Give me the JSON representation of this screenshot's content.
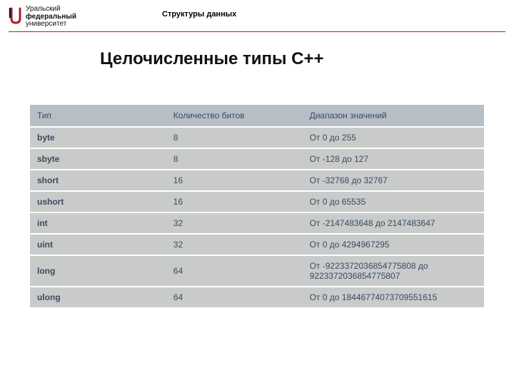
{
  "logo": {
    "line1": "Уральский",
    "line2_bold": "федеральный",
    "line3": "университет"
  },
  "course_label": "Структуры данных",
  "title": "Целочисленные типы С++",
  "table": {
    "headers": [
      "Тип",
      "Количество битов",
      "Диапазон значений"
    ],
    "rows": [
      {
        "type": "byte",
        "bits": "8",
        "range": "От 0 до 255"
      },
      {
        "type": "sbyte",
        "bits": "8",
        "range": "От -128 до 127"
      },
      {
        "type": "short",
        "bits": "16",
        "range": "От -32768 до 32767"
      },
      {
        "type": "ushort",
        "bits": "16",
        "range": "От 0 до 65535"
      },
      {
        "type": "int",
        "bits": "32",
        "range": "От -2147483648 до 2147483647"
      },
      {
        "type": "uint",
        "bits": "32",
        "range": "От 0 до 4294967295"
      },
      {
        "type": "long",
        "bits": "64",
        "range": "От -9223372036854775808 до 9223372036854775807"
      },
      {
        "type": "ulong",
        "bits": "64",
        "range": "От 0 до 18446774073709551615"
      }
    ]
  }
}
